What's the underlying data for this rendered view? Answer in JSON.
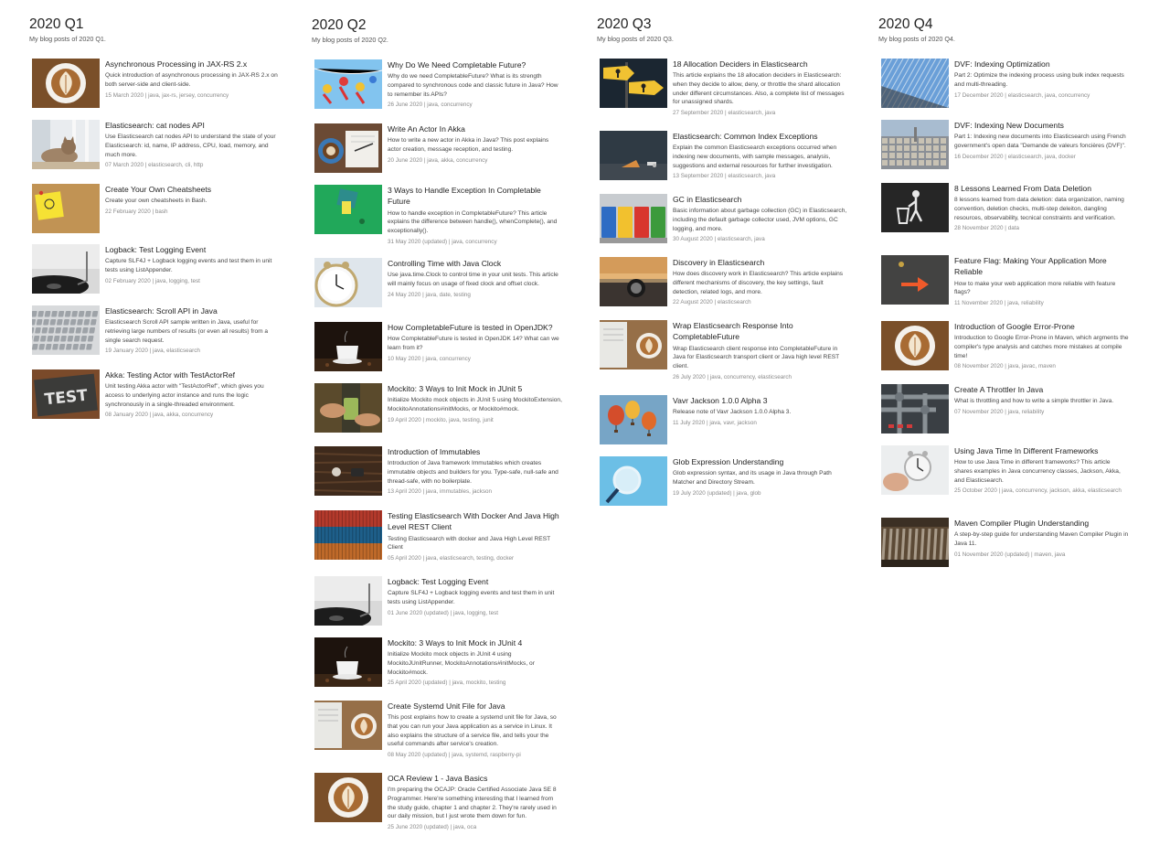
{
  "quarters": [
    {
      "title": "2020 Q1",
      "subtitle": "My blog posts of 2020 Q1.",
      "posts": [
        {
          "title": "Asynchronous Processing in JAX-RS 2.x",
          "desc": "Quick introduction of asynchronous processing in JAX-RS 2.x on both server-side and client-side.",
          "meta": "15 March 2020 | java, jax-rs, jersey, concurrency",
          "image": "latte"
        },
        {
          "title": "Elasticsearch: cat nodes API",
          "desc": "Use Elasticsearch cat nodes API to understand the state of your Elasticsearch: id, name, IP address, CPU, load, memory, and much more.",
          "meta": "07 March 2020 | elasticsearch, cli, http",
          "image": "cat"
        },
        {
          "title": "Create Your Own Cheatsheets",
          "desc": "Create your own cheatsheets in Bash.",
          "meta": "22 February 2020 | bash",
          "image": "bulb"
        },
        {
          "title": "Logback: Test Logging Event",
          "desc": "Capture SLF4J + Logback logging events and test them in unit tests using ListAppender.",
          "meta": "02 February 2020 | java, logging, test",
          "image": "record"
        },
        {
          "title": "Elasticsearch: Scroll API in Java",
          "desc": "Elasticsearch Scroll API sample written in Java, useful for retrieving large numbers of results (or even all results) from a single search request.",
          "meta": "19 January 2020 | java, elasticsearch",
          "image": "keys"
        },
        {
          "title": "Akka: Testing Actor with TestActorRef",
          "desc": "Unit testing Akka actor with \"TestActorRef\", which gives you access to underlying actor instance and runs the logic synchronously in a single-threaded environment.",
          "meta": "08 January 2020 | java, akka, concurrency",
          "image": "test"
        }
      ]
    },
    {
      "title": "2020 Q2",
      "subtitle": "My blog posts of 2020 Q2.",
      "posts": [
        {
          "title": "Why Do We Need Completable Future?",
          "desc": "Why do we need CompletableFuture? What is its strength compared to synchronous code and classic future in Java? How to remember its APIs?",
          "meta": "26 June 2020 | java, concurrency",
          "image": "figures"
        },
        {
          "title": "Write An Actor In Akka",
          "desc": "How to write a new actor in Akka in Java? This post explains actor creation, message reception, and testing.",
          "meta": "20 June 2020 | java, akka, concurrency",
          "image": "notebook"
        },
        {
          "title": "3 Ways to Handle Exception In Completable Future",
          "desc": "How to handle exception in CompletableFuture? This article explains the difference between handle(), whenComplete(), and exceptionally().",
          "meta": "31 May 2020 (updated) | java, concurrency",
          "image": "green"
        },
        {
          "title": "Controlling Time with Java Clock",
          "desc": "Use java.time.Clock to control time in your unit tests. This article will mainly focus on usage of fixed clock and offset clock.",
          "meta": "24 May 2020 | java, date, testing",
          "image": "clock"
        },
        {
          "title": "How CompletableFuture is tested in OpenJDK?",
          "desc": "How CompletableFuture is tested in OpenJDK 14? What can we learn from it?",
          "meta": "10 May 2020 | java, concurrency",
          "image": "coffee"
        },
        {
          "title": "Mockito: 3 Ways to Init Mock in JUnit 5",
          "desc": "Initialize Mockito mock objects in JUnit 5 using MockitoExtension, MockitoAnnotations#initMocks, or Mockito#mock.",
          "meta": "19 April 2020 | mockito, java, testing, junit",
          "image": "hands"
        },
        {
          "title": "Introduction of Immutables",
          "desc": "Introduction of Java framework Immutables which creates immutable objects and builders for you. Type-safe, null-safe and thread-safe, with no boilerplate.",
          "meta": "13 April 2020 | java, immutables, jackson",
          "image": "wood"
        },
        {
          "title": "Testing Elasticsearch With Docker And Java High Level REST Client",
          "desc": "Testing Elasticsearch with docker and Java High Level REST Client",
          "meta": "05 April 2020 | java, elasticsearch, testing, docker",
          "image": "containers"
        },
        {
          "title": "Logback: Test Logging Event",
          "desc": "Capture SLF4J + Logback logging events and test them in unit tests using ListAppender.",
          "meta": "01 June 2020 (updated) | java, logging, test",
          "image": "record"
        },
        {
          "title": "Mockito: 3 Ways to Init Mock in JUnit 4",
          "desc": "Initialize Mockito mock objects in JUnit 4 using MockitoJUnitRunner, MockitoAnnotations#initMocks, or Mockito#mock.",
          "meta": "25 April 2020 (updated) | java, mockito, testing",
          "image": "coffee"
        },
        {
          "title": "Create Systemd Unit File for Java",
          "desc": "This post explains how to create a systemd unit file for Java, so that you can run your Java application as a service in Linux. It also explains the structure of a service file, and tells your the useful commands after service's creation.",
          "meta": "08 May 2020 (updated) | java, systemd, raspberry-pi",
          "image": "desk"
        },
        {
          "title": "OCA Review 1 - Java Basics",
          "desc": "I'm preparing the OCAJP: Oracle Certified Associate Java SE 8 Programmer. Here're something interesting that I learned from the study guide, chapter 1 and chapter 2. They're rarely used in our daily mission, but I just wrote them down for fun.",
          "meta": "25 June 2020 (updated) | java, oca",
          "image": "latte"
        }
      ]
    },
    {
      "title": "2020 Q3",
      "subtitle": "My blog posts of 2020 Q3.",
      "posts": [
        {
          "title": "18 Allocation Deciders in Elasticsearch",
          "desc": "This article explains the 18 allocation deciders in Elasticsearch: when they decide to allow, deny, or throttle the shard allocation under different circumstances. Also, a complete list of messages for unassigned shards.",
          "meta": "27 September 2020 | elasticsearch, java",
          "image": "signs"
        },
        {
          "title": "Elasticsearch: Common Index Exceptions",
          "desc": "Explain the common Elasticsearch exceptions occurred when indexing new documents, with sample messages, analysis, suggestions and external resources for further investigation.",
          "meta": "13 September 2020 | elasticsearch, java",
          "image": "cone"
        },
        {
          "title": "GC in Elasticsearch",
          "desc": "Basic information about garbage collection (GC) in Elasticsearch, including the default garbage collector used, JVM options, GC logging, and more.",
          "meta": "30 August 2020 | elasticsearch, java",
          "image": "bins"
        },
        {
          "title": "Discovery in Elasticsearch",
          "desc": "How does discovery work in Elasticsearch? This article explains different mechanisms of discovery, the key settings, fault detection, related logs, and more.",
          "meta": "22 August 2020 | elasticsearch",
          "image": "compass"
        },
        {
          "title": "Wrap Elasticsearch Response Into CompletableFuture",
          "desc": "Wrap Elasticsearch client response into CompletableFuture in Java for Elasticsearch transport client or Java high level REST client.",
          "meta": "26 July 2020 | java, concurrency, elasticsearch",
          "image": "desk"
        },
        {
          "title": "Vavr Jackson 1.0.0 Alpha 3",
          "desc": "Release note of Vavr Jackson 1.0.0 Alpha 3.",
          "meta": "11 July 2020 | java, vavr, jackson",
          "image": "balloons"
        },
        {
          "title": "Glob Expression Understanding",
          "desc": "Glob expression syntax, and its usage in Java through Path Matcher and Directory Stream.",
          "meta": "19 July 2020 (updated) | java, glob",
          "image": "magnifier"
        }
      ]
    },
    {
      "title": "2020 Q4",
      "subtitle": "My blog posts of 2020 Q4.",
      "posts": [
        {
          "title": "DVF: Indexing Optimization",
          "desc": "Part 2: Optimize the indexing process using bulk index requests and multi-threading.",
          "meta": "17 December 2020 | elasticsearch, java, concurrency",
          "image": "glass"
        },
        {
          "title": "DVF: Indexing New Documents",
          "desc": "Part 1: Indexing new documents into Elasticsearch using French government's open data \"Demande de valeurs foncières (DVF)\".",
          "meta": "16 December 2020 | elasticsearch, java, docker",
          "image": "city"
        },
        {
          "title": "8 Lessons Learned From Data Deletion",
          "desc": "8 lessons learned from data deletion: data organization, naming convention, deletion checks, multi-step deleiton, dangling resources, observability, tecnical constraints and verification.",
          "meta": "28 November 2020 | data",
          "image": "trash"
        },
        {
          "title": "Feature Flag: Making Your Application More Reliable",
          "desc": "How to make your web application more reliable with feature flags?",
          "meta": "11 November 2020 | java, reliability",
          "image": "arrow"
        },
        {
          "title": "Introduction of Google Error-Prone",
          "desc": "Introduction to Google Error-Prone in Maven, which argments the compiler's type analysis and catches more mistakes at compile time!",
          "meta": "08 November 2020 | java, javac, maven",
          "image": "latte"
        },
        {
          "title": "Create A Throttler In Java",
          "desc": "What is throttling and how to write a simple throttler in Java.",
          "meta": "07 November 2020 | java, reliability",
          "image": "pipes"
        },
        {
          "title": "Using Java Time In Different Frameworks",
          "desc": "How to use Java Time in different frameworks? This article shares examples in Java concurrency classes, Jackson, Akka, and Elasticsearch.",
          "meta": "25 October 2020 | java, concurrency, jackson, akka, elasticsearch",
          "image": "watch"
        },
        {
          "title": "Maven Compiler Plugin Understanding",
          "desc": "A step-by-step guide for understanding Maven Compiler Plugin in Java 11.",
          "meta": "01 November 2020 (updated) | maven, java",
          "image": "tools"
        }
      ]
    }
  ]
}
